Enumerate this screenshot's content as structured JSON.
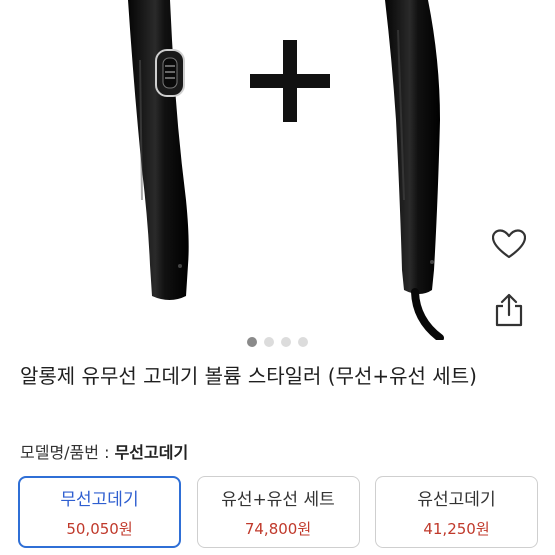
{
  "product": {
    "title": "알롱제 유무선 고데기 볼륨 스타일러 (무선+유선 세트)",
    "model_label": "모델명/품번 : ",
    "model_value": "무선고데기"
  },
  "gallery": {
    "image_count": 4,
    "active_index": 0
  },
  "actions": {
    "wishlist_icon": "heart-icon",
    "share_icon": "share-icon"
  },
  "options": [
    {
      "name": "무선고데기",
      "price": "50,050원",
      "selected": true
    },
    {
      "name": "유선+유선 세트",
      "price": "74,800원",
      "selected": false
    },
    {
      "name": "유선고데기",
      "price": "41,250원",
      "selected": false
    }
  ],
  "colors": {
    "accent": "#2f6fd6",
    "price": "#c0392b"
  }
}
